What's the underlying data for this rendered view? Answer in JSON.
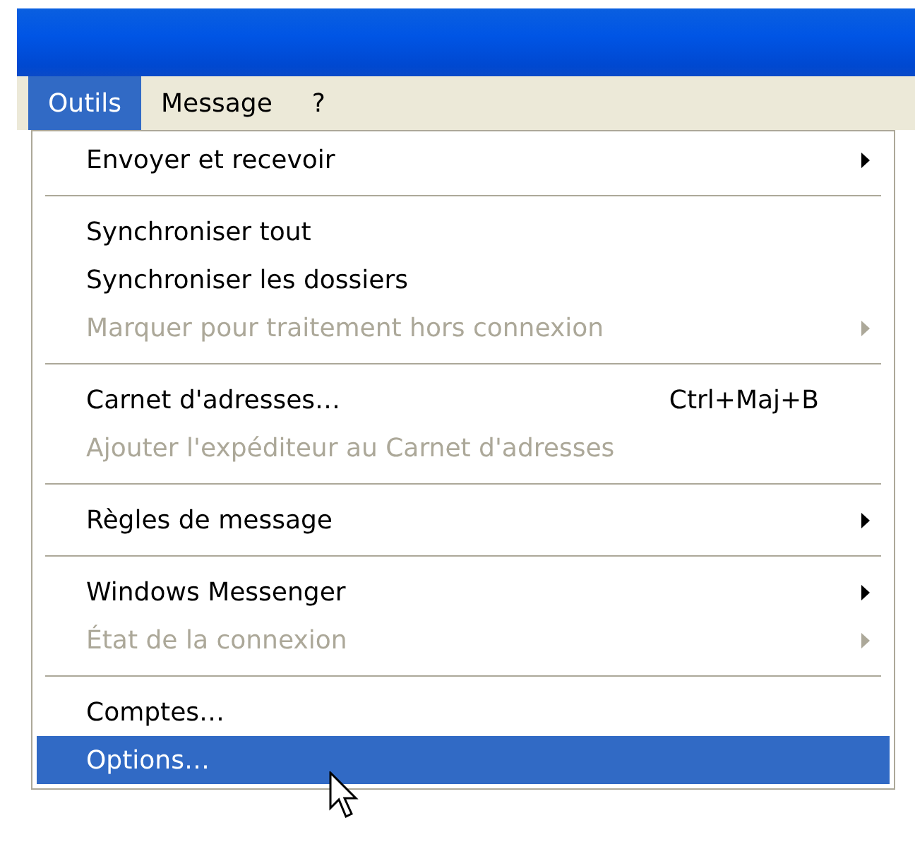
{
  "menubar": [
    {
      "label": "Outils",
      "selected": true
    },
    {
      "label": "Message",
      "selected": false
    },
    {
      "label": "?",
      "selected": false
    }
  ],
  "menu": {
    "groups": [
      [
        {
          "label": "Envoyer et recevoir",
          "submenu": true,
          "disabled": false,
          "selected": false
        }
      ],
      [
        {
          "label": "Synchroniser tout",
          "submenu": false,
          "disabled": false,
          "selected": false
        },
        {
          "label": "Synchroniser les dossiers",
          "submenu": false,
          "disabled": false,
          "selected": false
        },
        {
          "label": "Marquer pour traitement hors connexion",
          "submenu": true,
          "disabled": true,
          "selected": false
        }
      ],
      [
        {
          "label": "Carnet d'adresses…",
          "shortcut": "Ctrl+Maj+B",
          "submenu": false,
          "disabled": false,
          "selected": false
        },
        {
          "label": "Ajouter l'expéditeur au Carnet d'adresses",
          "submenu": false,
          "disabled": true,
          "selected": false
        }
      ],
      [
        {
          "label": "Règles de message",
          "submenu": true,
          "disabled": false,
          "selected": false
        }
      ],
      [
        {
          "label": "Windows Messenger",
          "submenu": true,
          "disabled": false,
          "selected": false
        },
        {
          "label": "État de la connexion",
          "submenu": true,
          "disabled": true,
          "selected": false
        }
      ],
      [
        {
          "label": "Comptes…",
          "submenu": false,
          "disabled": false,
          "selected": false
        },
        {
          "label": "Options…",
          "submenu": false,
          "disabled": false,
          "selected": true
        }
      ]
    ]
  }
}
